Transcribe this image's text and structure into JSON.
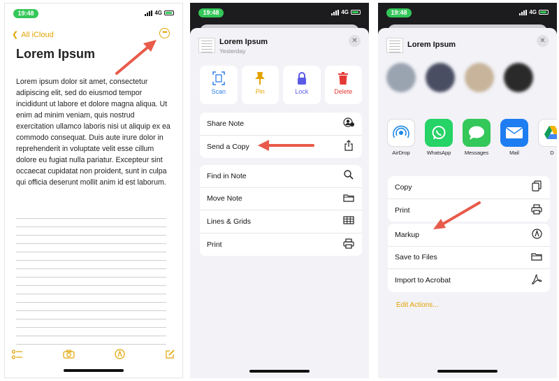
{
  "colors": {
    "accent": "#e2a300",
    "status_green": "#34c759",
    "arrow": "#e85a4a",
    "delete_red": "#e53935",
    "lock_blue": "#5a5ae6",
    "scan_blue": "#2f7ee8"
  },
  "status": {
    "time": "19:48",
    "network": "4G"
  },
  "phone1": {
    "back_label": "All iCloud",
    "more_icon": "ellipsis-circle-icon",
    "note_title": "Lorem Ipsum",
    "note_body": "Lorem ipsum dolor sit amet, consectetur adipiscing elit, sed do eiusmod tempor incididunt ut labore et dolore magna aliqua. Ut enim ad minim veniam, quis nostrud exercitation ullamco laboris nisi ut aliquip ex ea commodo consequat. Duis aute irure dolor in reprehenderit in voluptate velit esse cillum dolore eu fugiat nulla pariatur. Excepteur sint occaecat cupidatat non proident, sunt in culpa qui officia deserunt mollit anim id est laborum.",
    "toolbar_icons": [
      "checklist-icon",
      "camera-icon",
      "markup-pen-icon",
      "compose-icon"
    ]
  },
  "phone2": {
    "title": "Lorem Ipsum",
    "subtitle": "Yesterday",
    "quick_actions": [
      {
        "label": "Scan",
        "icon": "scan-doc-icon",
        "color": "#2f7ee8"
      },
      {
        "label": "Pin",
        "icon": "pin-icon",
        "color": "#e2a300"
      },
      {
        "label": "Lock",
        "icon": "lock-icon",
        "color": "#5a5ae6"
      },
      {
        "label": "Delete",
        "icon": "trash-icon",
        "color": "#e53935"
      }
    ],
    "group1": [
      {
        "label": "Share Note",
        "icon": "person-plus-icon"
      },
      {
        "label": "Send a Copy",
        "icon": "share-icon"
      }
    ],
    "group2": [
      {
        "label": "Find in Note",
        "icon": "magnifier-icon"
      },
      {
        "label": "Move Note",
        "icon": "folder-icon"
      },
      {
        "label": "Lines & Grids",
        "icon": "grid-icon"
      },
      {
        "label": "Print",
        "icon": "printer-icon"
      }
    ]
  },
  "phone3": {
    "title": "Lorem Ipsum",
    "apps": [
      {
        "label": "AirDrop",
        "icon": "airdrop-icon",
        "color": "#1e88e5"
      },
      {
        "label": "WhatsApp",
        "icon": "whatsapp-icon",
        "color": "#25d366"
      },
      {
        "label": "Messages",
        "icon": "messages-icon",
        "color": "#34c759"
      },
      {
        "label": "Mail",
        "icon": "mail-icon",
        "color": "#1e7df0"
      },
      {
        "label": "D",
        "icon": "drive-icon",
        "color": "#f4b400"
      }
    ],
    "group1": [
      {
        "label": "Copy",
        "icon": "copy-icon"
      },
      {
        "label": "Print",
        "icon": "printer-icon"
      }
    ],
    "group2": [
      {
        "label": "Markup",
        "icon": "markup-pen-icon"
      },
      {
        "label": "Save to Files",
        "icon": "folder-icon"
      },
      {
        "label": "Import to Acrobat",
        "icon": "acrobat-icon"
      }
    ],
    "edit_actions": "Edit Actions..."
  }
}
